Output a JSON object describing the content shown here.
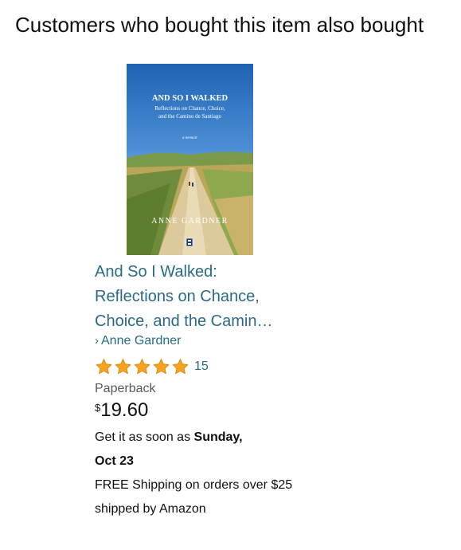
{
  "section": {
    "heading": "Customers who bought this item also bought"
  },
  "product": {
    "cover": {
      "title": "AND SO I WALKED",
      "subtitle_line1": "Reflections on Chance, Choice,",
      "subtitle_line2": "and the Camino de Santiago",
      "tagline": "a memoir",
      "author": "ANNE GARDNER"
    },
    "title": "And So I Walked: Reflections on Chance, Choice, and the Camin…",
    "author_chevron": "›",
    "author": "Anne Gardner",
    "rating": {
      "stars": 5,
      "max_stars": 5,
      "star_color": "#f7a31c",
      "count": "15"
    },
    "format": "Paperback",
    "price": {
      "currency": "$",
      "amount": "19.60"
    },
    "delivery": {
      "prefix": "Get it as soon as",
      "date_line1": "Sunday,",
      "date_line2": "Oct 23"
    },
    "shipping": "FREE Shipping on orders over $25 shipped by Amazon"
  },
  "colors": {
    "link": "#2a6a86",
    "text": "#0f1111",
    "secondary_text": "#565959"
  }
}
